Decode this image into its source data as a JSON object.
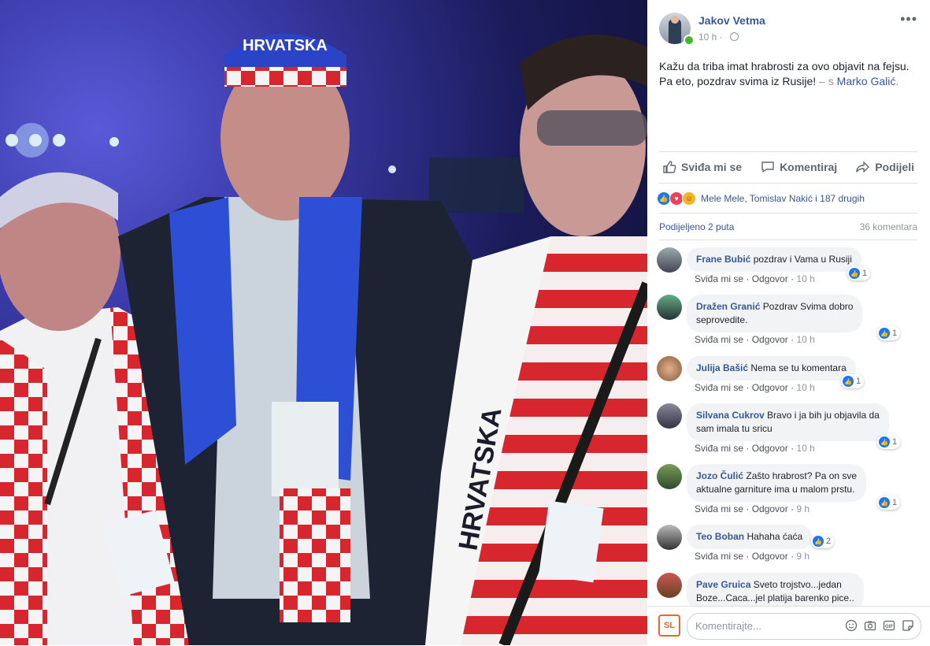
{
  "post": {
    "author": "Jakov Vetma",
    "time": "10 h ·",
    "text_line1": "Kažu da triba imat hrabrosti za ovo objavit na fejsu.",
    "text_line2": "Pa eto, pozdrav svima iz Rusije!",
    "tag_prefix": " – s ",
    "tagged": "Marko Galić",
    "tag_suffix": "."
  },
  "photo": {
    "cap_text": "HRVATSKA",
    "scarf_text_left": "HRVATSKA",
    "scarf_text_right": "HRVATSKA"
  },
  "actions": {
    "like": "Sviđa mi se",
    "comment": "Komentiraj",
    "share": "Podijeli"
  },
  "reactions": {
    "names": "Mele Mele, Tomislav Nakić i 187 drugih"
  },
  "stats": {
    "shares": "Podijeljeno 2 puta",
    "comments": "36 komentara"
  },
  "comments": [
    {
      "name": "Frane Bubić",
      "text1": "pozdrav i Vama u Rusiji",
      "text2": "",
      "likes": "1",
      "like_label": "Sviđa mi se",
      "reply_label": "Odgovor",
      "time": "10 h"
    },
    {
      "name": "Dražen Granić",
      "text1": "Pozdrav Svima dobro",
      "text2": "seprovedite.",
      "likes": "1",
      "like_label": "Sviđa mi se",
      "reply_label": "Odgovor",
      "time": "10 h"
    },
    {
      "name": "Julija Bašić",
      "text1": "Nema se tu komentara",
      "text2": "",
      "likes": "1",
      "like_label": "Sviđa mi se",
      "reply_label": "Odgovor",
      "time": "10 h"
    },
    {
      "name": "Silvana Cukrov",
      "text1": "Bravo i ja bih ju objavila da",
      "text2": "sam imala tu sricu",
      "likes": "1",
      "like_label": "Sviđa mi se",
      "reply_label": "Odgovor",
      "time": "10 h"
    },
    {
      "name": "Jozo Čulić",
      "text1": "Zašto hrabrost? Pa on sve",
      "text2": "aktualne garniture ima u malom prstu.",
      "likes": "1",
      "like_label": "Sviđa mi se",
      "reply_label": "Odgovor",
      "time": "9 h"
    },
    {
      "name": "Teo Boban",
      "text1": "Hahaha ćaća",
      "text2": "",
      "likes": "2",
      "like_label": "Sviđa mi se",
      "reply_label": "Odgovor",
      "time": "9 h"
    },
    {
      "name": "Pave Gruica",
      "text1": "Sveto trojstvo...jedan",
      "text2": "Boze...Caca...jel platija barenko pice..",
      "likes": "",
      "like_label": "",
      "reply_label": "",
      "time": ""
    }
  ],
  "composer": {
    "logo": "SL",
    "placeholder": "Komentirajte..."
  },
  "colors": {
    "link": "#365899",
    "like_blue": "#1877f2",
    "online": "#42b72a",
    "scarf_red": "#d7262d"
  },
  "icons": [
    "more-icon",
    "globe-icon",
    "like-icon",
    "comment-icon",
    "share-icon",
    "emoji-icon",
    "camera-icon",
    "gif-icon",
    "sticker-icon"
  ]
}
